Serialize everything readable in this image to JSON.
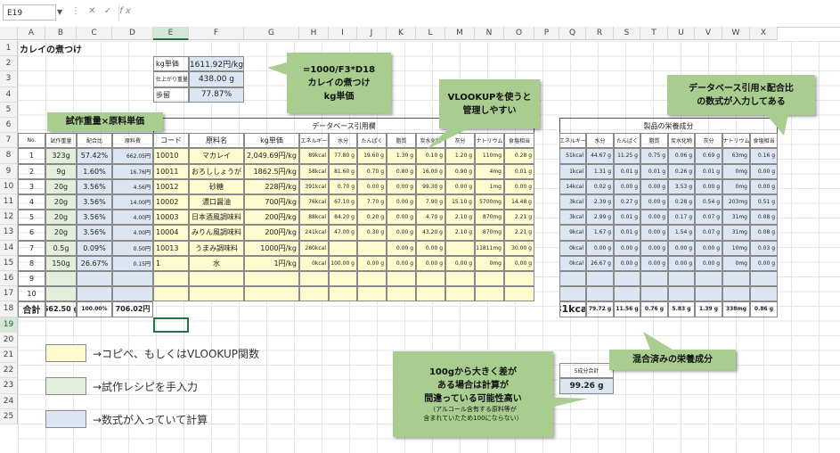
{
  "formula_bar": {
    "name_box": "E19",
    "fx": "fx",
    "formula": ""
  },
  "columns": [
    "A",
    "B",
    "C",
    "D",
    "E",
    "F",
    "G",
    "H",
    "I",
    "J",
    "K",
    "L",
    "M",
    "N",
    "O",
    "P",
    "Q",
    "R",
    "S",
    "T",
    "U",
    "V",
    "W",
    "X"
  ],
  "selected_column": "E",
  "rows": [
    "1",
    "2",
    "3",
    "4",
    "5",
    "6",
    "7",
    "8",
    "9",
    "10",
    "11",
    "12",
    "13",
    "14",
    "15",
    "16",
    "17",
    "18",
    "19",
    "20",
    "21",
    "22",
    "23",
    "24",
    "25"
  ],
  "selected_row": "19",
  "title": "カレイの煮つけ",
  "info_box": [
    {
      "label": "kg単価",
      "value": "1611.92円/kg"
    },
    {
      "label": "仕上がり重量",
      "value": "438.00 g"
    },
    {
      "label": "歩留",
      "value": "77.87%"
    }
  ],
  "db_header": "データベース引用欄",
  "nutrition_header": "製品の栄養成分",
  "left_headers": [
    "No.",
    "試作重量",
    "配合比",
    "原料費"
  ],
  "db_headers": [
    "コード",
    "原料名",
    "kg単価",
    "エネルギー",
    "水分",
    "たんぱく",
    "脂質",
    "炭水化物",
    "灰分",
    "ナトリウム",
    "食塩相当"
  ],
  "nut_headers": [
    "エネルギー",
    "水分",
    "たんぱく",
    "脂質",
    "炭水化物",
    "灰分",
    "ナトリウム",
    "食塩相当"
  ],
  "data_rows": [
    {
      "no": "1",
      "w": "323g",
      "ratio": "57.42%",
      "cost": "662.05円",
      "code": "10010",
      "name": "マカレイ",
      "kg": "2,049.69円/kg",
      "e": "89kcal",
      "wa": "77.80 g",
      "p": "19.60 g",
      "f": "1.30 g",
      "c": "0.10 g",
      "a": "1.20 g",
      "na": "110mg",
      "s": "0.28 g",
      "ne": "51kcal",
      "nwa": "44.67 g",
      "np": "11.25 g",
      "nf": "0.75 g",
      "nc": "0.06 g",
      "na2": "0.69 g",
      "nna": "63mg",
      "ns": "0.16 g"
    },
    {
      "no": "2",
      "w": "9g",
      "ratio": "1.60%",
      "cost": "16.76円",
      "code": "10011",
      "name": "おろししょうが",
      "kg": "1862.5円/kg",
      "e": "58kcal",
      "wa": "81.60 g",
      "p": "0.70 g",
      "f": "0.80 g",
      "c": "16.00 g",
      "a": "0.90 g",
      "na": "4mg",
      "s": "0.01 g",
      "ne": "1kcal",
      "nwa": "1.31 g",
      "np": "0.01 g",
      "nf": "0.01 g",
      "nc": "0.26 g",
      "na2": "0.01 g",
      "nna": "0mg",
      "ns": "0.00 g"
    },
    {
      "no": "3",
      "w": "20g",
      "ratio": "3.56%",
      "cost": "4.56円",
      "code": "10012",
      "name": "砂糖",
      "kg": "228円/kg",
      "e": "391kcal",
      "wa": "0.70 g",
      "p": "0.00 g",
      "f": "0.00 g",
      "c": "99.30 g",
      "a": "0.00 g",
      "na": "1mg",
      "s": "0.00 g",
      "ne": "14kcal",
      "nwa": "0.02 g",
      "np": "0.00 g",
      "nf": "0.00 g",
      "nc": "3.53 g",
      "na2": "0.00 g",
      "nna": "0mg",
      "ns": "0.00 g"
    },
    {
      "no": "4",
      "w": "20g",
      "ratio": "3.56%",
      "cost": "14.00円",
      "code": "10002",
      "name": "濃口醤油",
      "kg": "700円/kg",
      "e": "76kcal",
      "wa": "67.10 g",
      "p": "7.70 g",
      "f": "0.00 g",
      "c": "7.90 g",
      "a": "15.10 g",
      "na": "5700mg",
      "s": "14.48 g",
      "ne": "3kcal",
      "nwa": "2.39 g",
      "np": "0.27 g",
      "nf": "0.00 g",
      "nc": "0.28 g",
      "na2": "0.54 g",
      "nna": "203mg",
      "ns": "0.51 g"
    },
    {
      "no": "5",
      "w": "20g",
      "ratio": "3.56%",
      "cost": "4.00円",
      "code": "10003",
      "name": "日本酒風調味料",
      "kg": "200円/kg",
      "e": "88kcal",
      "wa": "84.20 g",
      "p": "0.20 g",
      "f": "0.00 g",
      "c": "4.70 g",
      "a": "2.10 g",
      "na": "870mg",
      "s": "2.21 g",
      "ne": "3kcal",
      "nwa": "2.99 g",
      "np": "0.01 g",
      "nf": "0.00 g",
      "nc": "0.17 g",
      "na2": "0.07 g",
      "nna": "31mg",
      "ns": "0.08 g"
    },
    {
      "no": "6",
      "w": "20g",
      "ratio": "3.56%",
      "cost": "4.00円",
      "code": "10004",
      "name": "みりん風調味料",
      "kg": "200円/kg",
      "e": "241kcal",
      "wa": "47.00 g",
      "p": "0.30 g",
      "f": "0.00 g",
      "c": "43.20 g",
      "a": "2.10 g",
      "na": "870mg",
      "s": "2.21 g",
      "ne": "9kcal",
      "nwa": "1.67 g",
      "np": "0.01 g",
      "nf": "0.00 g",
      "nc": "1.54 g",
      "na2": "0.07 g",
      "nna": "31mg",
      "ns": "0.08 g"
    },
    {
      "no": "7",
      "w": "0.5g",
      "ratio": "0.09%",
      "cost": "0.50円",
      "code": "10013",
      "name": "うまみ調味料",
      "kg": "1000円/kg",
      "e": "280kcal",
      "wa": "",
      "p": "",
      "f": "0.00 g",
      "c": "0.00 g",
      "a": "",
      "na": "11811mg",
      "s": "30.00 g",
      "ne": "0kcal",
      "nwa": "0.00 g",
      "np": "0.00 g",
      "nf": "0.00 g",
      "nc": "0.00 g",
      "na2": "0.00 g",
      "nna": "10mg",
      "ns": "0.03 g"
    },
    {
      "no": "8",
      "w": "150g",
      "ratio": "26.67%",
      "cost": "0.15円",
      "code": "1",
      "name": "水",
      "kg": "1円/kg",
      "e": "0kcal",
      "wa": "100.00 g",
      "p": "0.00 g",
      "f": "0.00 g",
      "c": "0.00 g",
      "a": "0.00 g",
      "na": "0mg",
      "s": "0.00 g",
      "ne": "0kcal",
      "nwa": "26.67 g",
      "np": "0.00 g",
      "nf": "0.00 g",
      "nc": "0.00 g",
      "na2": "0.00 g",
      "nna": "0mg",
      "ns": "0.00 g"
    },
    {
      "no": "9",
      "w": "",
      "ratio": "",
      "cost": "",
      "code": "",
      "name": "",
      "kg": "",
      "e": "",
      "wa": "",
      "p": "",
      "f": "",
      "c": "",
      "a": "",
      "na": "",
      "s": "",
      "ne": "",
      "nwa": "",
      "np": "",
      "nf": "",
      "nc": "",
      "na2": "",
      "nna": "",
      "ns": ""
    },
    {
      "no": "10",
      "w": "",
      "ratio": "",
      "cost": "",
      "code": "",
      "name": "",
      "kg": "",
      "e": "",
      "wa": "",
      "p": "",
      "f": "",
      "c": "",
      "a": "",
      "na": "",
      "s": "",
      "ne": "",
      "nwa": "",
      "np": "",
      "nf": "",
      "nc": "",
      "na2": "",
      "nna": "",
      "ns": ""
    }
  ],
  "total_row": {
    "label": "合計",
    "w": "562.50 g",
    "ratio": "100.00%",
    "cost": "706.02円",
    "ne": "81kcal",
    "nwa": "79.72 g",
    "np": "11.56 g",
    "nf": "0.76 g",
    "nc": "5.83 g",
    "na2": "1.39 g",
    "nna": "338mg",
    "ns": "0.86 g"
  },
  "sum_box": {
    "label": "5成分合計",
    "value": "99.26 g"
  },
  "legend": [
    {
      "color": "#fdfbcf",
      "text": "→コピペ、もしくはVLOOKUP関数"
    },
    {
      "color": "#e4efdb",
      "text": "→試作レシピを手入力"
    },
    {
      "color": "#dce6f2",
      "text": "→数式が入っていて計算"
    }
  ],
  "callouts": {
    "formula": [
      "=1000/F3*D18",
      "カレイの煮つけ",
      "kg単価"
    ],
    "vlookup": [
      "VLOOKUPを使うと",
      "管理しやすい"
    ],
    "db_ratio": [
      "データベース引用×配合比",
      "の数式が入力してある"
    ],
    "cost": [
      "試作重量×原料単価"
    ],
    "mixed": [
      "混合済みの栄養成分"
    ],
    "warning": [
      "100gから大きく差が",
      "ある場合は計算が",
      "間違っている可能性高い"
    ],
    "warning_note": [
      "（アルコール含有する原料等が",
      "含まれていたため100にならない）"
    ]
  }
}
